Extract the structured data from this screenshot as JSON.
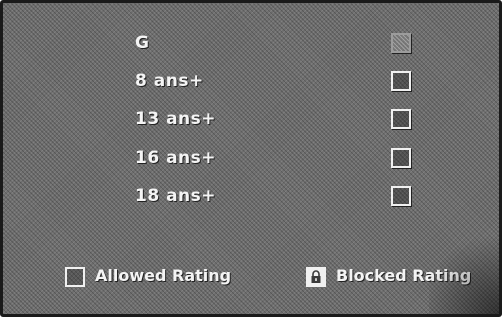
{
  "ratings": [
    {
      "label": "G",
      "checkbox": "unchecked",
      "selected": true
    },
    {
      "label": "8 ans+",
      "checkbox": "unchecked",
      "selected": false
    },
    {
      "label": "13 ans+",
      "checkbox": "unchecked",
      "selected": false
    },
    {
      "label": "16 ans+",
      "checkbox": "unchecked",
      "selected": false
    },
    {
      "label": "18 ans+",
      "checkbox": "unchecked",
      "selected": false
    }
  ],
  "legend": {
    "allowed_label": "Allowed Rating",
    "allowed_icon": "empty-box-icon",
    "blocked_label": "Blocked Rating",
    "blocked_icon": "lock-icon"
  },
  "colors": {
    "background": "#6f6f6f",
    "text": "#f4f4f4",
    "border": "#1a1a1a"
  }
}
